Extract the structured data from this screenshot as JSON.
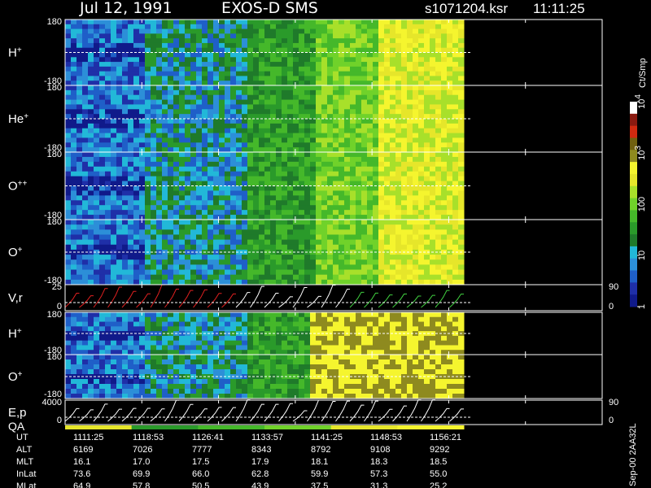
{
  "header": {
    "date": "Jul 12, 1991",
    "instrument": "EXOS-D SMS",
    "file": "s1071204.ksr",
    "time": "11:11:25"
  },
  "footer_note": "Sep-00 2AA32L",
  "colorbar": {
    "unit": "Ct/Smp",
    "ticks": [
      {
        "label": "1",
        "value": 1
      },
      {
        "label": "10",
        "value": 10
      },
      {
        "label": "100",
        "value": 100
      },
      {
        "label": "10^3",
        "value": 1000
      },
      {
        "label": "10^4",
        "value": 10000
      }
    ],
    "colors": [
      "#101a8a",
      "#1f2fa8",
      "#1f5fc8",
      "#2c8fd8",
      "#22b8d8",
      "#1f7a2a",
      "#2a9a2a",
      "#45b82a",
      "#70d22a",
      "#a8e02a",
      "#e6e62a",
      "#f5f52e",
      "#8e8a1f",
      "#706010",
      "#d02a10",
      "#8a1a10",
      "#ffffff"
    ]
  },
  "chart_data": {
    "type": "heatmap",
    "title": "Jul 12, 1991 EXOS-D SMS",
    "xaxis": {
      "label": "UT",
      "ticks": [
        "1111:25",
        "1118:53",
        "1126:41",
        "1133:57",
        "1141:25",
        "1148:53",
        "1156:21"
      ]
    },
    "panels": [
      {
        "name": "H+",
        "type": "heatmap",
        "ylim": [
          -180,
          180
        ],
        "tick_top": "180",
        "tick_bottom": "-180"
      },
      {
        "name": "He+",
        "type": "heatmap",
        "ylim": [
          -180,
          180
        ],
        "tick_top": "180",
        "tick_bottom": "-180"
      },
      {
        "name": "O++",
        "type": "heatmap",
        "ylim": [
          -180,
          180
        ],
        "tick_top": "180",
        "tick_bottom": "-180"
      },
      {
        "name": "O+",
        "type": "heatmap",
        "ylim": [
          -180,
          180
        ],
        "tick_top": "180",
        "tick_bottom": "-180"
      },
      {
        "name": "V,r",
        "type": "line",
        "ylim": [
          0,
          25
        ],
        "tick_top": "25",
        "tick_bottom": "0",
        "right_top": "90",
        "right_bottom": "0"
      },
      {
        "name": "H+",
        "type": "heatmap",
        "ylim": [
          -180,
          180
        ],
        "tick_top": "180",
        "tick_bottom": "-180"
      },
      {
        "name": "O+",
        "type": "heatmap",
        "ylim": [
          -180,
          180
        ],
        "tick_top": "180",
        "tick_bottom": "-180"
      },
      {
        "name": "E,p",
        "name2": "QA",
        "type": "line",
        "ylim": [
          0,
          4000
        ],
        "tick_top": "4000",
        "tick_bottom": "0",
        "right_top": "90",
        "right_bottom": "0"
      }
    ],
    "ephemeris": {
      "rows": [
        {
          "label": "UT",
          "values": [
            "1111:25",
            "1118:53",
            "1126:41",
            "1133:57",
            "1141:25",
            "1148:53",
            "1156:21"
          ]
        },
        {
          "label": "ALT",
          "values": [
            "6169",
            "7026",
            "7777",
            "8343",
            "8792",
            "9108",
            "9292"
          ]
        },
        {
          "label": "MLT",
          "values": [
            "16.1",
            "17.0",
            "17.5",
            "17.9",
            "18.1",
            "18.3",
            "18.5"
          ]
        },
        {
          "label": "InLat",
          "values": [
            "73.6",
            "69.9",
            "66.0",
            "62.8",
            "59.9",
            "57.3",
            "55.0"
          ]
        },
        {
          "label": "MLat",
          "values": [
            "64.9",
            "57.8",
            "50.5",
            "43.9",
            "37.5",
            "31.3",
            "25.2"
          ]
        }
      ]
    }
  }
}
